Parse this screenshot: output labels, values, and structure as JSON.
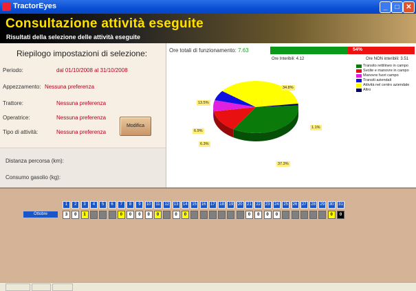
{
  "window": {
    "title": "TractorEyes"
  },
  "header": {
    "title": "Consultazione attività eseguite",
    "subtitle": "Risultati della selezione delle attività eseguite"
  },
  "settings": {
    "heading": "Riepilogo impostazioni di selezione:",
    "rows": [
      {
        "label": "Periodo:",
        "value": "dal 01/10/2008 al 31/10/2008"
      },
      {
        "label": "Appezzamento:",
        "value": "Nessuna preferenza"
      },
      {
        "label": "Trattore:",
        "value": "Nessuna preferenza"
      },
      {
        "label": "Operatrice:",
        "value": "Nessuna preferenza"
      },
      {
        "label": "Tipo di attività:",
        "value": "Nessuna preferenza"
      }
    ],
    "modify_label": "Modifica",
    "distance_label": "Distanza percorsa (km):",
    "fuel_label": "Consumo gasolio (kg):"
  },
  "summary": {
    "ore_totali_label": "Ore totali di funzionamento:",
    "ore_totali_value": "7.63",
    "bar_percent_label": "54%",
    "bar_fraction": 0.54,
    "ore_interibili": "Ore Interibili: 4.12",
    "ore_non_interibili": "Ore NON interibili: 3.51",
    "bar_green": "#0a9a1a",
    "bar_red": "#e11111"
  },
  "legend": [
    {
      "label": "Transito rettilineo in campo",
      "color": "#0a7a0a"
    },
    {
      "label": "Svolte e manovre in campo",
      "color": "#e81010"
    },
    {
      "label": "Manovre fuori campo",
      "color": "#e020e0"
    },
    {
      "label": "Transiti aziendali",
      "color": "#1010e0"
    },
    {
      "label": "Attività nel centro aziendale",
      "color": "#ffff00"
    },
    {
      "label": "Altro",
      "color": "#000060"
    }
  ],
  "chart_data": {
    "type": "pie",
    "labels": [
      "Transito rettilineo in campo",
      "Svolte e manovre in campo",
      "Manovre fuori campo",
      "Transiti aziendali",
      "Attività nel centro aziendale",
      "Altro"
    ],
    "values": [
      34.8,
      13.5,
      6.9,
      6.3,
      37.3,
      1.1
    ],
    "value_labels": [
      "34.8%",
      "13.5%",
      "6.9%",
      "6.3%",
      "37.3%",
      "1.1%"
    ],
    "colors": [
      "#0a7a0a",
      "#e81010",
      "#e020e0",
      "#1010e0",
      "#ffff00",
      "#000060"
    ]
  },
  "calendar": {
    "month": "Ottobre",
    "days": [
      "1",
      "2",
      "3",
      "4",
      "5",
      "6",
      "7",
      "8",
      "9",
      "10",
      "11",
      "12",
      "13",
      "14",
      "15",
      "16",
      "17",
      "18",
      "19",
      "20",
      "21",
      "22",
      "23",
      "24",
      "25",
      "26",
      "27",
      "28",
      "29",
      "30",
      "31"
    ],
    "cells": [
      {
        "t": "3",
        "c": "w"
      },
      {
        "t": "0",
        "c": "w"
      },
      {
        "t": "1",
        "c": "y"
      },
      {
        "t": "",
        "c": "g"
      },
      {
        "t": "",
        "c": "g"
      },
      {
        "t": "",
        "c": "g"
      },
      {
        "t": "0",
        "c": "y"
      },
      {
        "t": "0",
        "c": "w"
      },
      {
        "t": "0",
        "c": "w"
      },
      {
        "t": "0",
        "c": "w"
      },
      {
        "t": "0",
        "c": "y"
      },
      {
        "t": "",
        "c": "g"
      },
      {
        "t": "0",
        "c": "w"
      },
      {
        "t": "0",
        "c": "y"
      },
      {
        "t": "",
        "c": "g"
      },
      {
        "t": "",
        "c": "g"
      },
      {
        "t": "",
        "c": "g"
      },
      {
        "t": "",
        "c": "g"
      },
      {
        "t": "",
        "c": "g"
      },
      {
        "t": "",
        "c": "g"
      },
      {
        "t": "0",
        "c": "w"
      },
      {
        "t": "0",
        "c": "w"
      },
      {
        "t": "0",
        "c": "w"
      },
      {
        "t": "0",
        "c": "w"
      },
      {
        "t": "",
        "c": "g"
      },
      {
        "t": "",
        "c": "g"
      },
      {
        "t": "",
        "c": "g"
      },
      {
        "t": "",
        "c": "g"
      },
      {
        "t": "",
        "c": "g"
      },
      {
        "t": "0",
        "c": "y"
      },
      {
        "t": "0",
        "c": "k"
      }
    ]
  }
}
